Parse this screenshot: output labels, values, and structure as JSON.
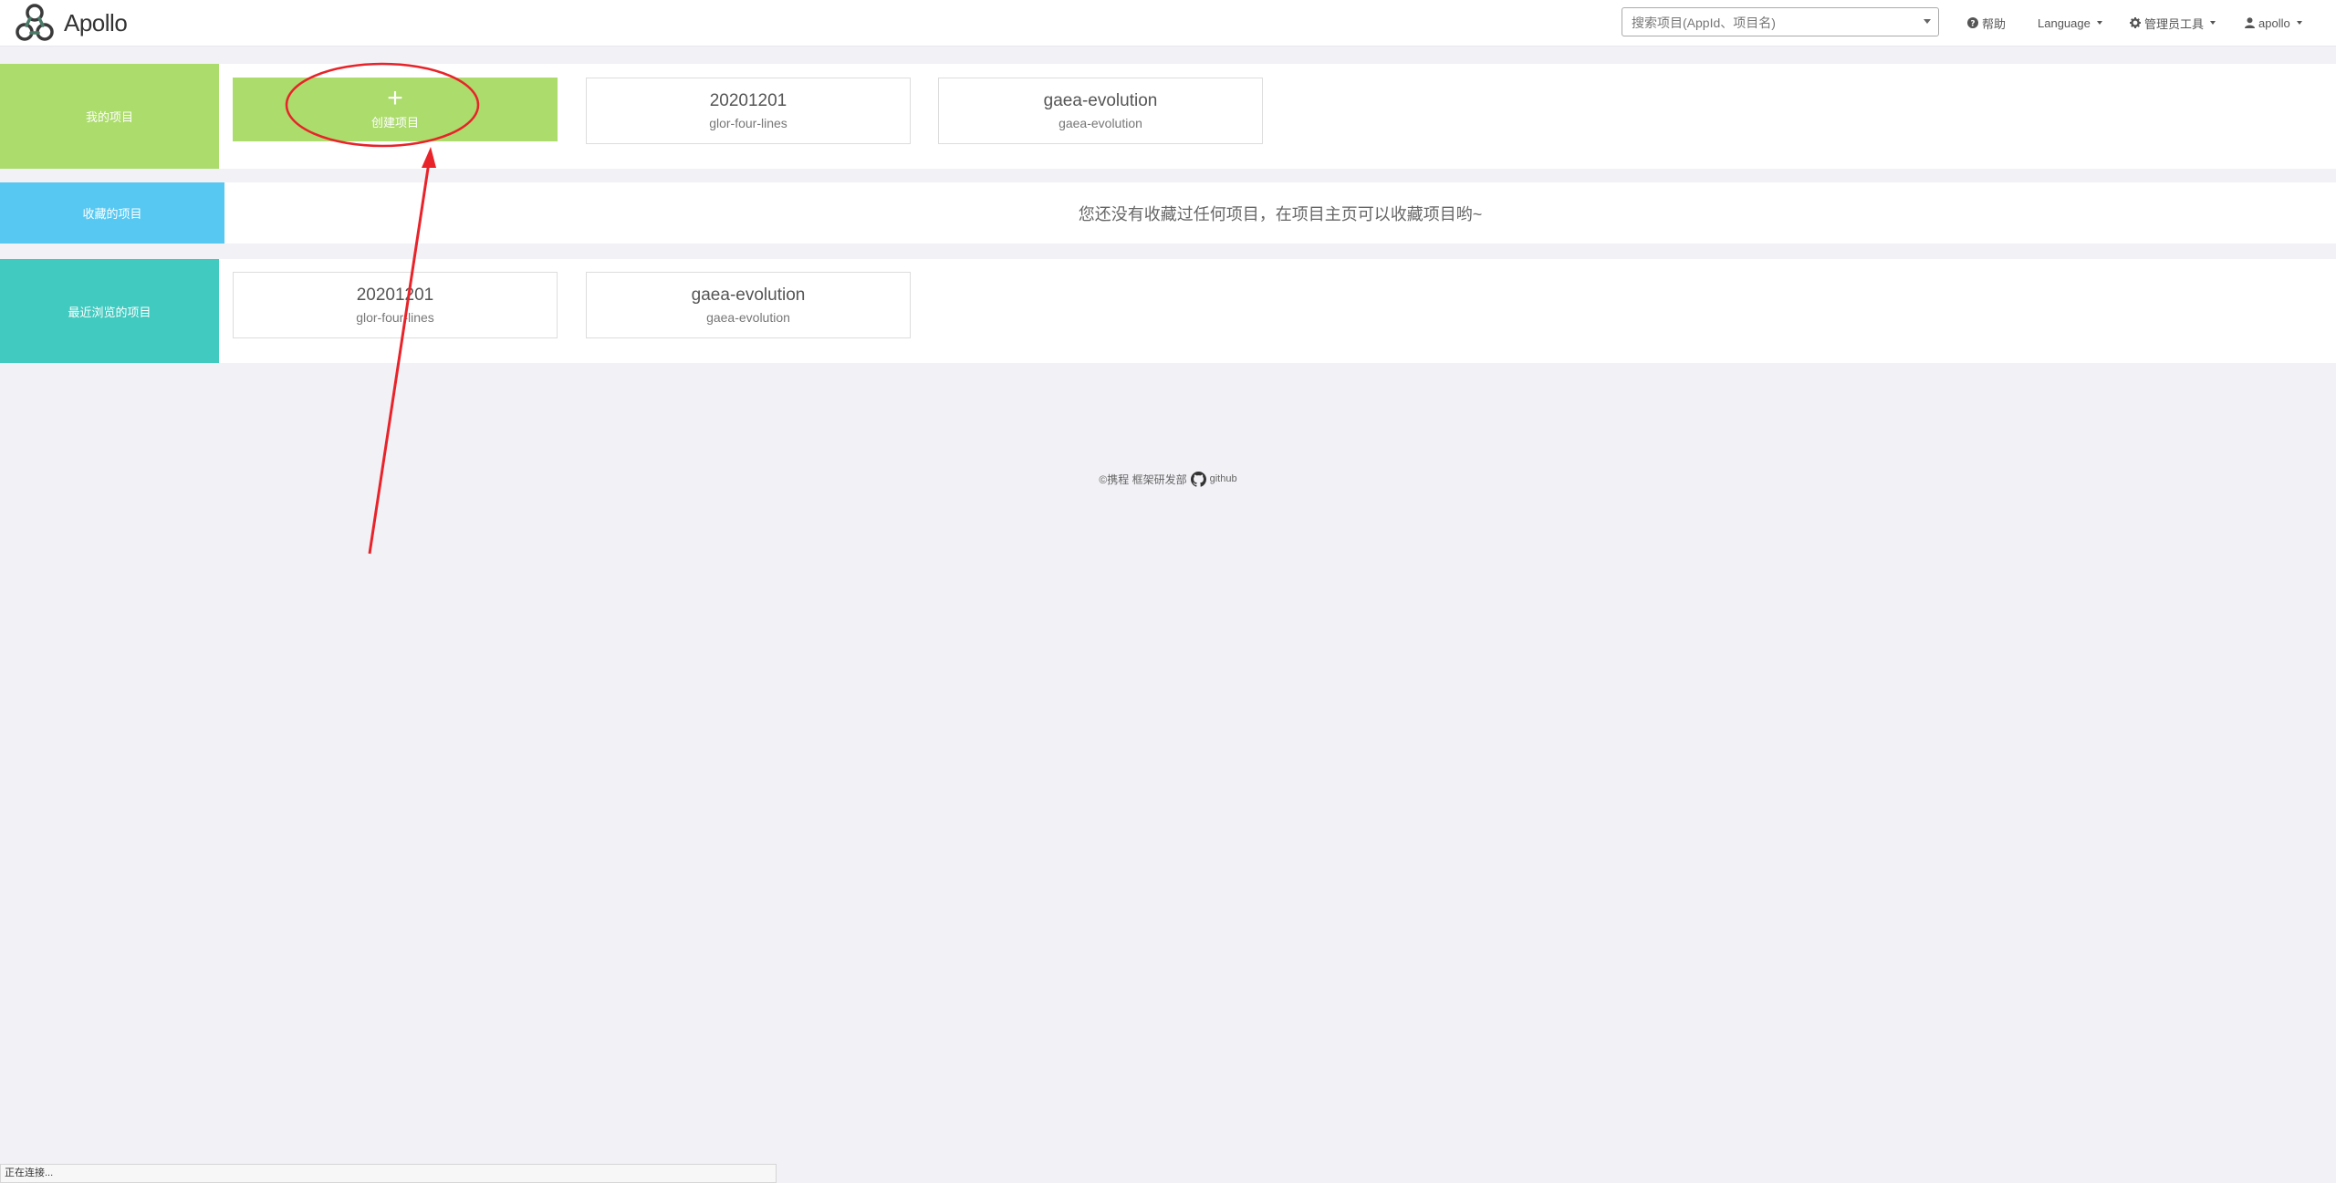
{
  "app": {
    "brand": "Apollo"
  },
  "header": {
    "search_placeholder": "搜索项目(AppId、项目名)",
    "help": "帮助",
    "language": "Language",
    "admin_tools": "管理员工具",
    "user": "apollo"
  },
  "sections": {
    "my_projects": {
      "label": "我的项目",
      "color": "#acdc6c",
      "create_label": "创建项目",
      "cards": [
        {
          "title": "20201201",
          "subtitle": "glor-four-lines"
        },
        {
          "title": "gaea-evolution",
          "subtitle": "gaea-evolution"
        }
      ]
    },
    "favorites": {
      "label": "收藏的项目",
      "color": "#57c8f2",
      "empty_message": "您还没有收藏过任何项目，在项目主页可以收藏项目哟~"
    },
    "recent": {
      "label": "最近浏览的项目",
      "color": "#41cac0",
      "cards": [
        {
          "title": "20201201",
          "subtitle": "glor-four-lines"
        },
        {
          "title": "gaea-evolution",
          "subtitle": "gaea-evolution"
        }
      ]
    }
  },
  "footer": {
    "copyright": "©携程 框架研发部",
    "github": "github"
  },
  "statusbar": {
    "text": "正在连接..."
  },
  "annotation": {
    "color": "#e8232a"
  }
}
